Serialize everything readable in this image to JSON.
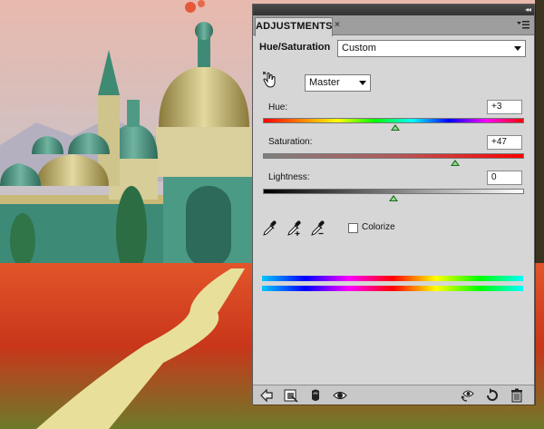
{
  "panel": {
    "tab_label": "ADJUSTMENTS",
    "tab_close": "×",
    "collapse_glyph": "◂◂",
    "title": "Hue/Saturation",
    "preset": "Custom",
    "channel": "Master"
  },
  "sliders": [
    {
      "label": "Hue:",
      "value": "+3",
      "range": [
        -180,
        180
      ],
      "position": 3
    },
    {
      "label": "Saturation:",
      "value": "+47",
      "range": [
        -100,
        100
      ],
      "position": 47
    },
    {
      "label": "Lightness:",
      "value": "0",
      "range": [
        -100,
        100
      ],
      "position": 0
    }
  ],
  "colorize": {
    "label": "Colorize",
    "checked": false
  },
  "colors": {
    "panel_bg": "#d6d6d6",
    "thumb": "#1a6b1a"
  },
  "icons": {
    "tools": [
      "targeted-adjustment-icon",
      "eyedropper-icon",
      "eyedropper-plus-icon",
      "eyedropper-minus-icon"
    ],
    "bottom": [
      "back-arrow-icon",
      "clip-to-layer-icon",
      "mask-icon",
      "visibility-eye-icon",
      "view-previous-icon",
      "reset-icon",
      "trash-icon"
    ]
  }
}
